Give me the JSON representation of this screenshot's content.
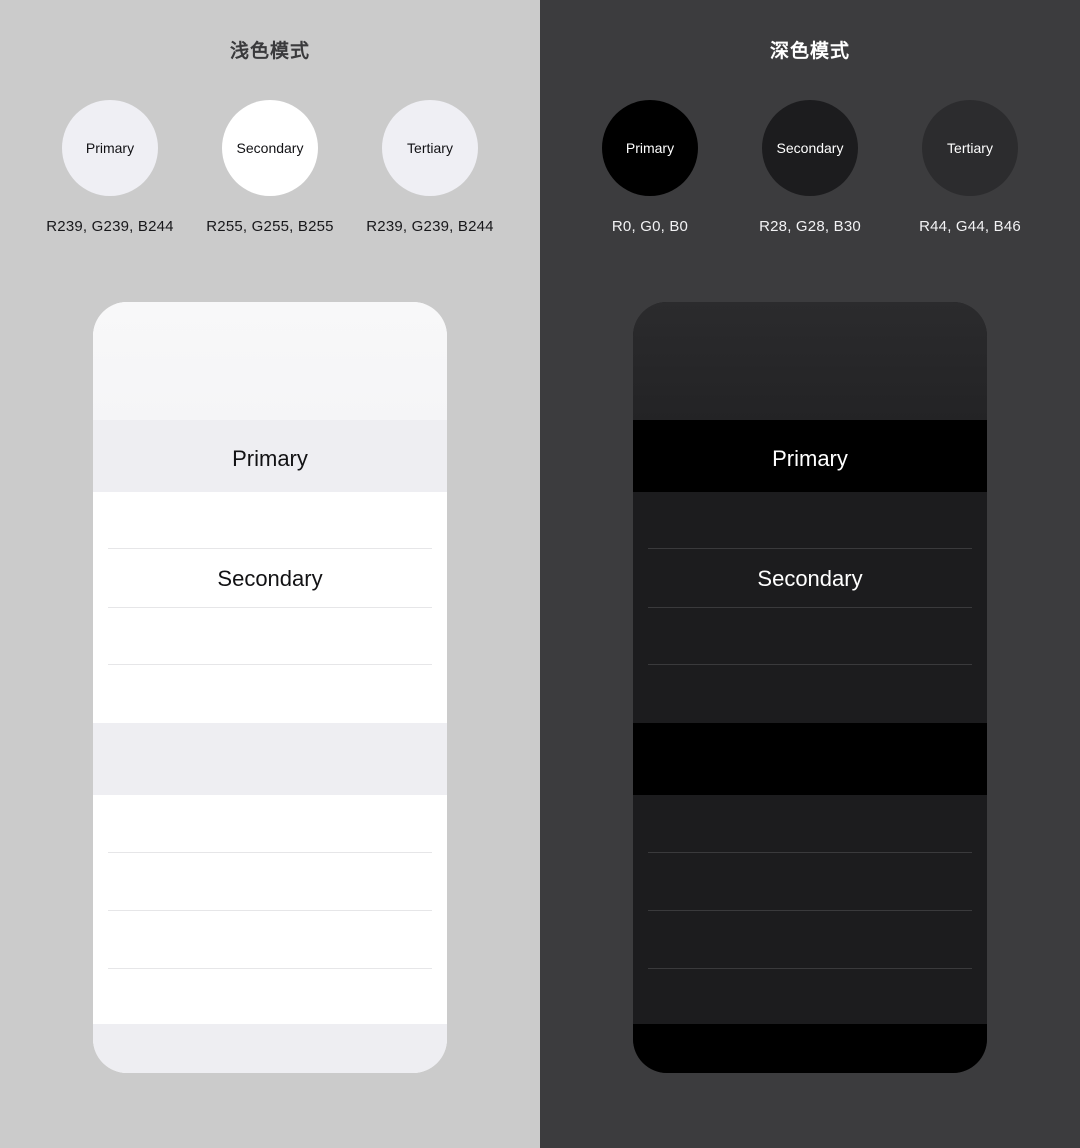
{
  "light": {
    "title": "浅色模式",
    "bg": "#cbcbcb",
    "swatches": [
      {
        "label": "Primary",
        "caption": "R239, G239, B244",
        "color": "#efeff4"
      },
      {
        "label": "Secondary",
        "caption": "R255, G255, B255",
        "color": "#ffffff"
      },
      {
        "label": "Tertiary",
        "caption": "R239, G239, B244",
        "color": "#efeff4"
      }
    ],
    "phone": {
      "base_color": "#ffffff",
      "top_gradient_from": "#f8f8f9",
      "top_gradient_to": "#f4f4f6",
      "band_color": "#eeeef2",
      "rule_color": "#e6e6e8",
      "primary_label": "Primary",
      "secondary_label": "Secondary"
    }
  },
  "dark": {
    "title": "深色模式",
    "bg": "#3c3c3e",
    "swatches": [
      {
        "label": "Primary",
        "caption": "R0, G0, B0",
        "color": "#000000"
      },
      {
        "label": "Secondary",
        "caption": "R28, G28, B30",
        "color": "#1c1c1e"
      },
      {
        "label": "Tertiary",
        "caption": "R44, G44, B46",
        "color": "#2c2c2e"
      }
    ],
    "phone": {
      "base_color": "#1c1c1e",
      "top_gradient_from": "#2a2a2c",
      "top_gradient_to": "#232325",
      "band_color": "#000000",
      "rule_color": "#3a3a3c",
      "primary_label": "Primary",
      "secondary_label": "Secondary"
    }
  }
}
